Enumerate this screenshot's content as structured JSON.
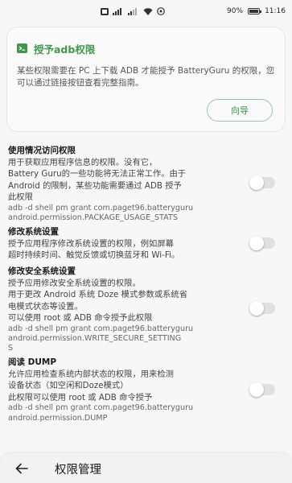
{
  "status_bar": {
    "battery": "90%",
    "battery_level": 0.9,
    "time": "11:16"
  },
  "card": {
    "title": "授予adb权限",
    "description": "某些权限需要在 PC 上下载 ADB 才能授予 BatteryGuru 的权限，您可以通过链接按钮查看完整指南。",
    "guide_button": "向导",
    "accent_color": "#3e9a48"
  },
  "permissions": [
    {
      "title": "使用情况访问权限",
      "lines": [
        "用于获取应用程序信息的权限。没有它，",
        "Battery Guru的一些功能将无法正常工作。由于",
        "Android 的限制，某些功能需要通过 ADB 授予",
        "此权限"
      ],
      "cmd": "adb -d shell pm grant com.paget96.batteryguru\nandroid.permission.PACKAGE_USAGE_STATS",
      "enabled": false
    },
    {
      "title": "修改系统设置",
      "lines": [
        "授予应用程序修改系统设置的权限，例如屏幕",
        "超时持续时间、触觉反馈或切换蓝牙和 Wi-Fi。"
      ],
      "cmd": "",
      "enabled": false
    },
    {
      "title": "修改安全系统设置",
      "lines": [
        "授予应用修改安全系统设置的权限。",
        "用于更改 Android 系统 Doze 模式参数或系统省",
        "电模式状态等设置。",
        "可以使用 root 或 ADB 命令授予此权限"
      ],
      "cmd": "adb -d shell pm grant com.paget96.batteryguru\nandroid.permission.WRITE_SECURE_SETTING\nS",
      "enabled": false
    },
    {
      "title": "阅读 DUMP",
      "lines": [
        "允许应用检查系统内部状态的权限，用来检测",
        "设备状态（如空闲和Doze模式）",
        "此权限可以使用 root 或 ADB 命令授予"
      ],
      "cmd": "adb -d shell pm grant com.paget96.batteryguru\nandroid.permission.DUMP",
      "enabled": false
    }
  ],
  "bottom_bar": {
    "title": "权限管理"
  }
}
